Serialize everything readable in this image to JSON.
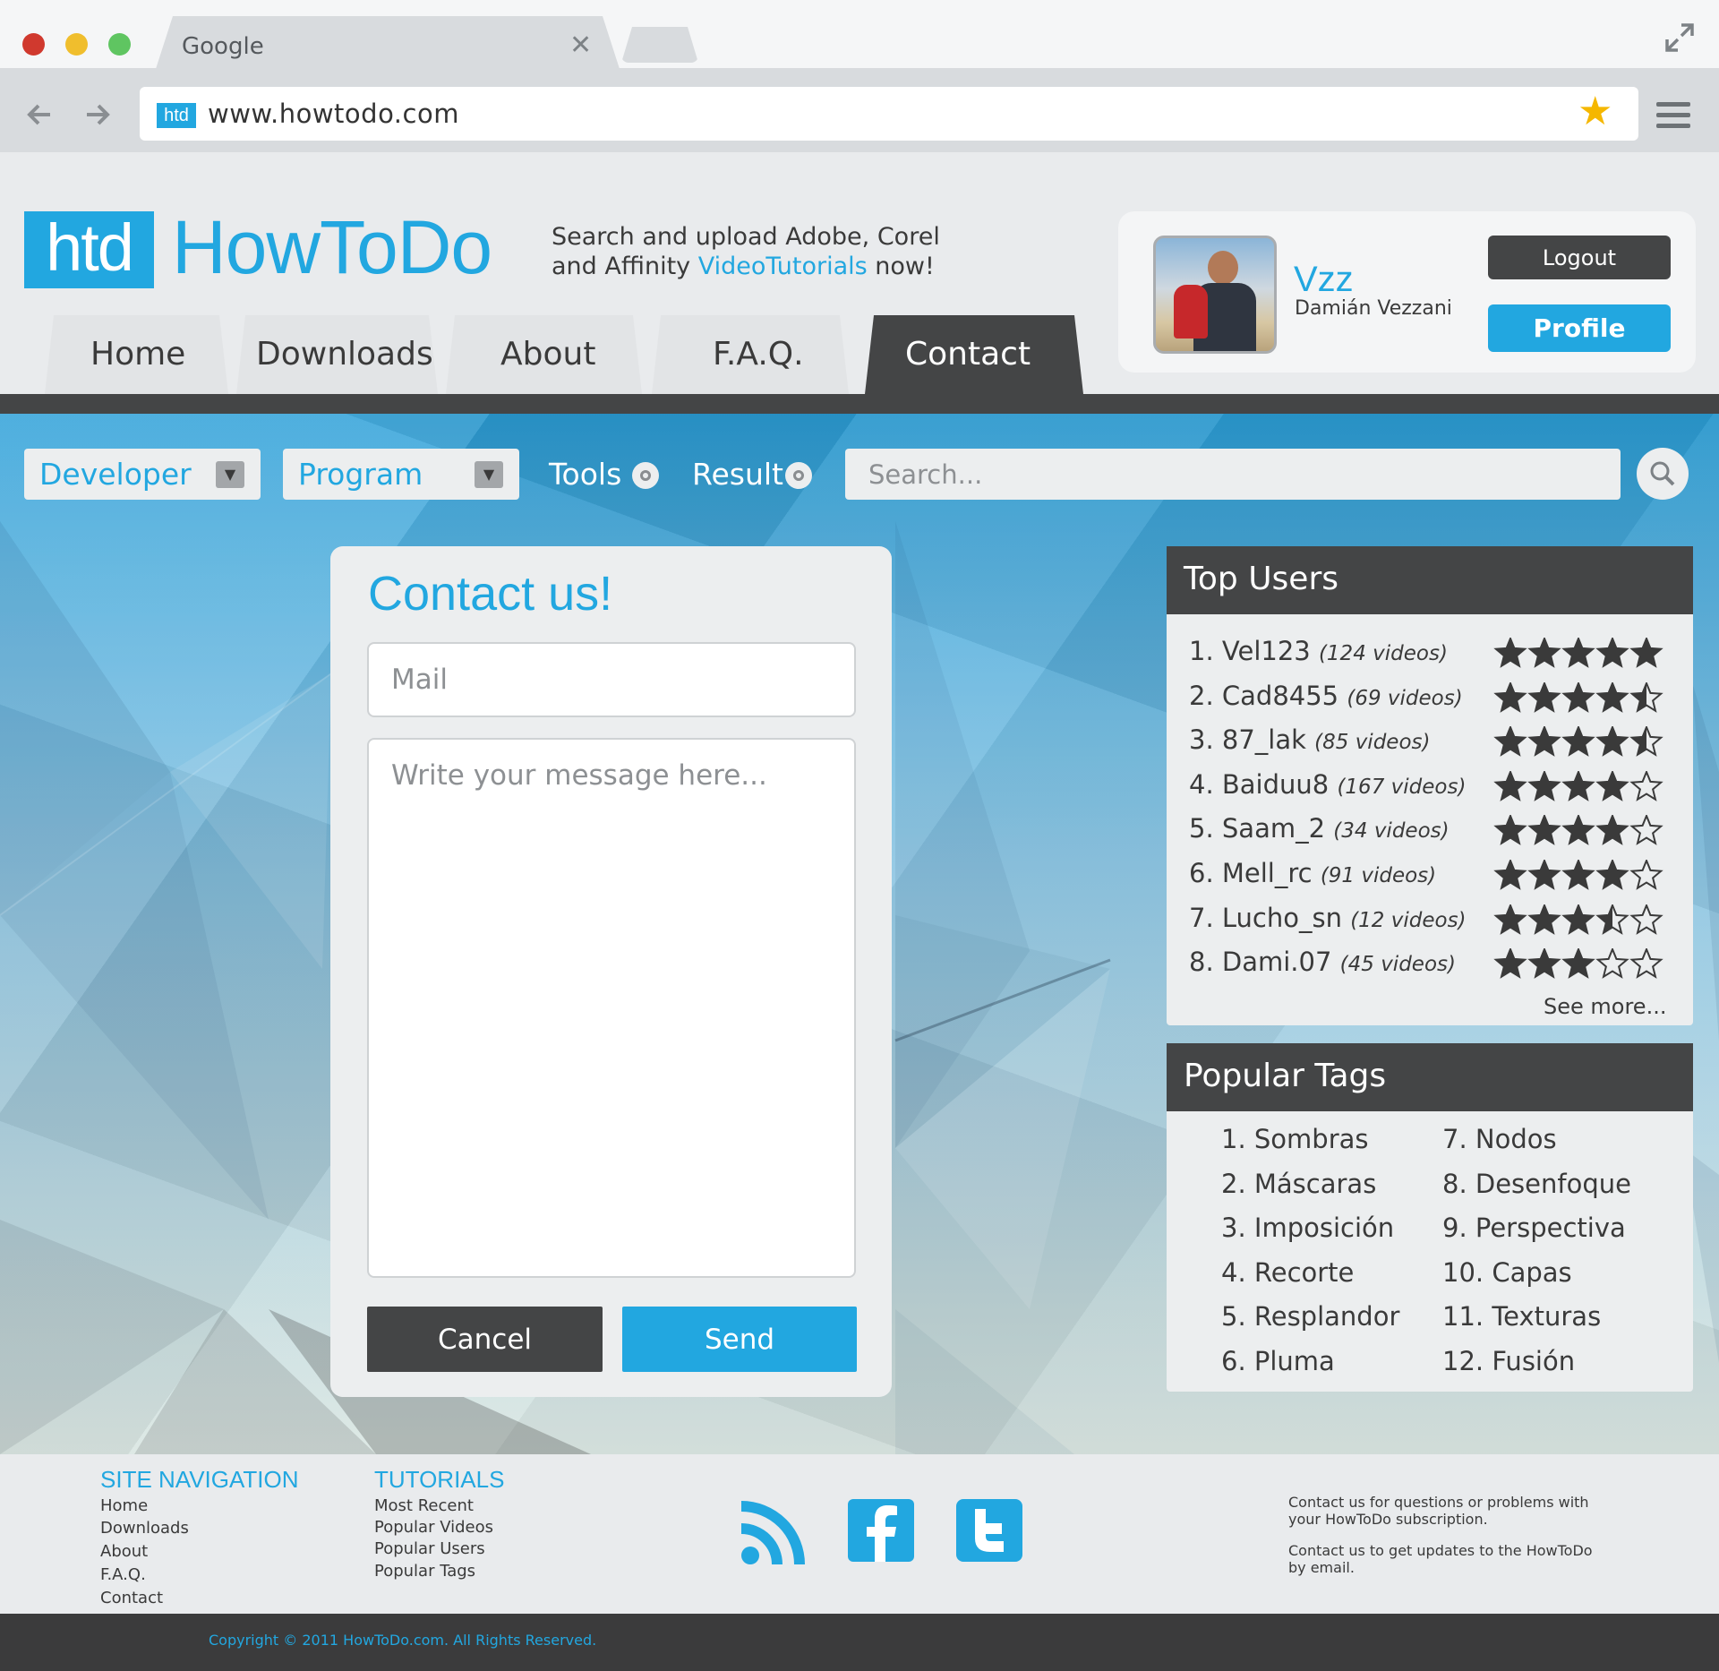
{
  "browser": {
    "tab_title": "Google",
    "url": "www.howtodo.com",
    "favicon_text": "htd"
  },
  "header": {
    "logo_mark": "htd",
    "logo_name": "HowToDo",
    "tagline_line1": "Search and upload Adobe, Corel",
    "tagline_line2_a": "and Affinity ",
    "tagline_line2_hl": "VideoTutorials",
    "tagline_line2_b": " now!"
  },
  "nav": {
    "tabs": [
      {
        "label": "Home"
      },
      {
        "label": "Downloads"
      },
      {
        "label": "About"
      },
      {
        "label": "F.A.Q."
      },
      {
        "label": "Contact",
        "active": true
      }
    ]
  },
  "user": {
    "username": "Vzz",
    "full_name": "Damián Vezzani",
    "logout_label": "Logout",
    "profile_label": "Profile"
  },
  "filters": {
    "developer": "Developer",
    "program": "Program",
    "tools": "Tools",
    "result": "Result",
    "search_placeholder": "Search..."
  },
  "contact": {
    "title": "Contact us!",
    "mail_placeholder": "Mail",
    "message_placeholder": "Write your message here...",
    "cancel_label": "Cancel",
    "send_label": "Send"
  },
  "top_users": {
    "title": "Top Users",
    "see_more": "See more...",
    "items": [
      {
        "rank": "1.",
        "name": "Vel123",
        "videos": "(124 videos)",
        "rating": 5
      },
      {
        "rank": "2.",
        "name": "Cad8455",
        "videos": "(69 videos)",
        "rating": 4.5
      },
      {
        "rank": "3.",
        "name": "87_lak",
        "videos": "(85 videos)",
        "rating": 4.5
      },
      {
        "rank": "4.",
        "name": "Baiduu8",
        "videos": "(167 videos)",
        "rating": 4
      },
      {
        "rank": "5.",
        "name": "Saam_2",
        "videos": "(34 videos)",
        "rating": 4
      },
      {
        "rank": "6.",
        "name": "Mell_rc",
        "videos": "(91 videos)",
        "rating": 4
      },
      {
        "rank": "7.",
        "name": "Lucho_sn",
        "videos": "(12 videos)",
        "rating": 3.5
      },
      {
        "rank": "8.",
        "name": "Dami.07",
        "videos": "(45 videos)",
        "rating": 3
      }
    ]
  },
  "popular_tags": {
    "title": "Popular Tags",
    "col1": [
      "1. Sombras",
      "2. Máscaras",
      "3. Imposición",
      "4. Recorte",
      "5. Resplandor",
      "6. Pluma"
    ],
    "col2": [
      "7. Nodos",
      "8. Desenfoque",
      "9. Perspectiva",
      "10. Capas",
      "11. Texturas",
      "12. Fusión"
    ]
  },
  "footer": {
    "site_nav_title": "SITE NAVIGATION",
    "site_nav_links": [
      "Home",
      "Downloads",
      "About",
      "F.A.Q.",
      "Contact"
    ],
    "tutorials_title": "TUTORIALS",
    "tutorials_links": [
      "Most Recent",
      "Popular Videos",
      "Popular Users",
      "Popular Tags"
    ],
    "note1": "Contact us for questions or problems with your HowToDo subscription.",
    "note2": "Contact us to get updates to the HowToDo by email.",
    "copyright": "Copyright © 2011 HowToDo.com. All Rights Reserved."
  },
  "colors": {
    "accent": "#22a7e0",
    "dark": "#444546",
    "star_gold": "#f5b700"
  }
}
